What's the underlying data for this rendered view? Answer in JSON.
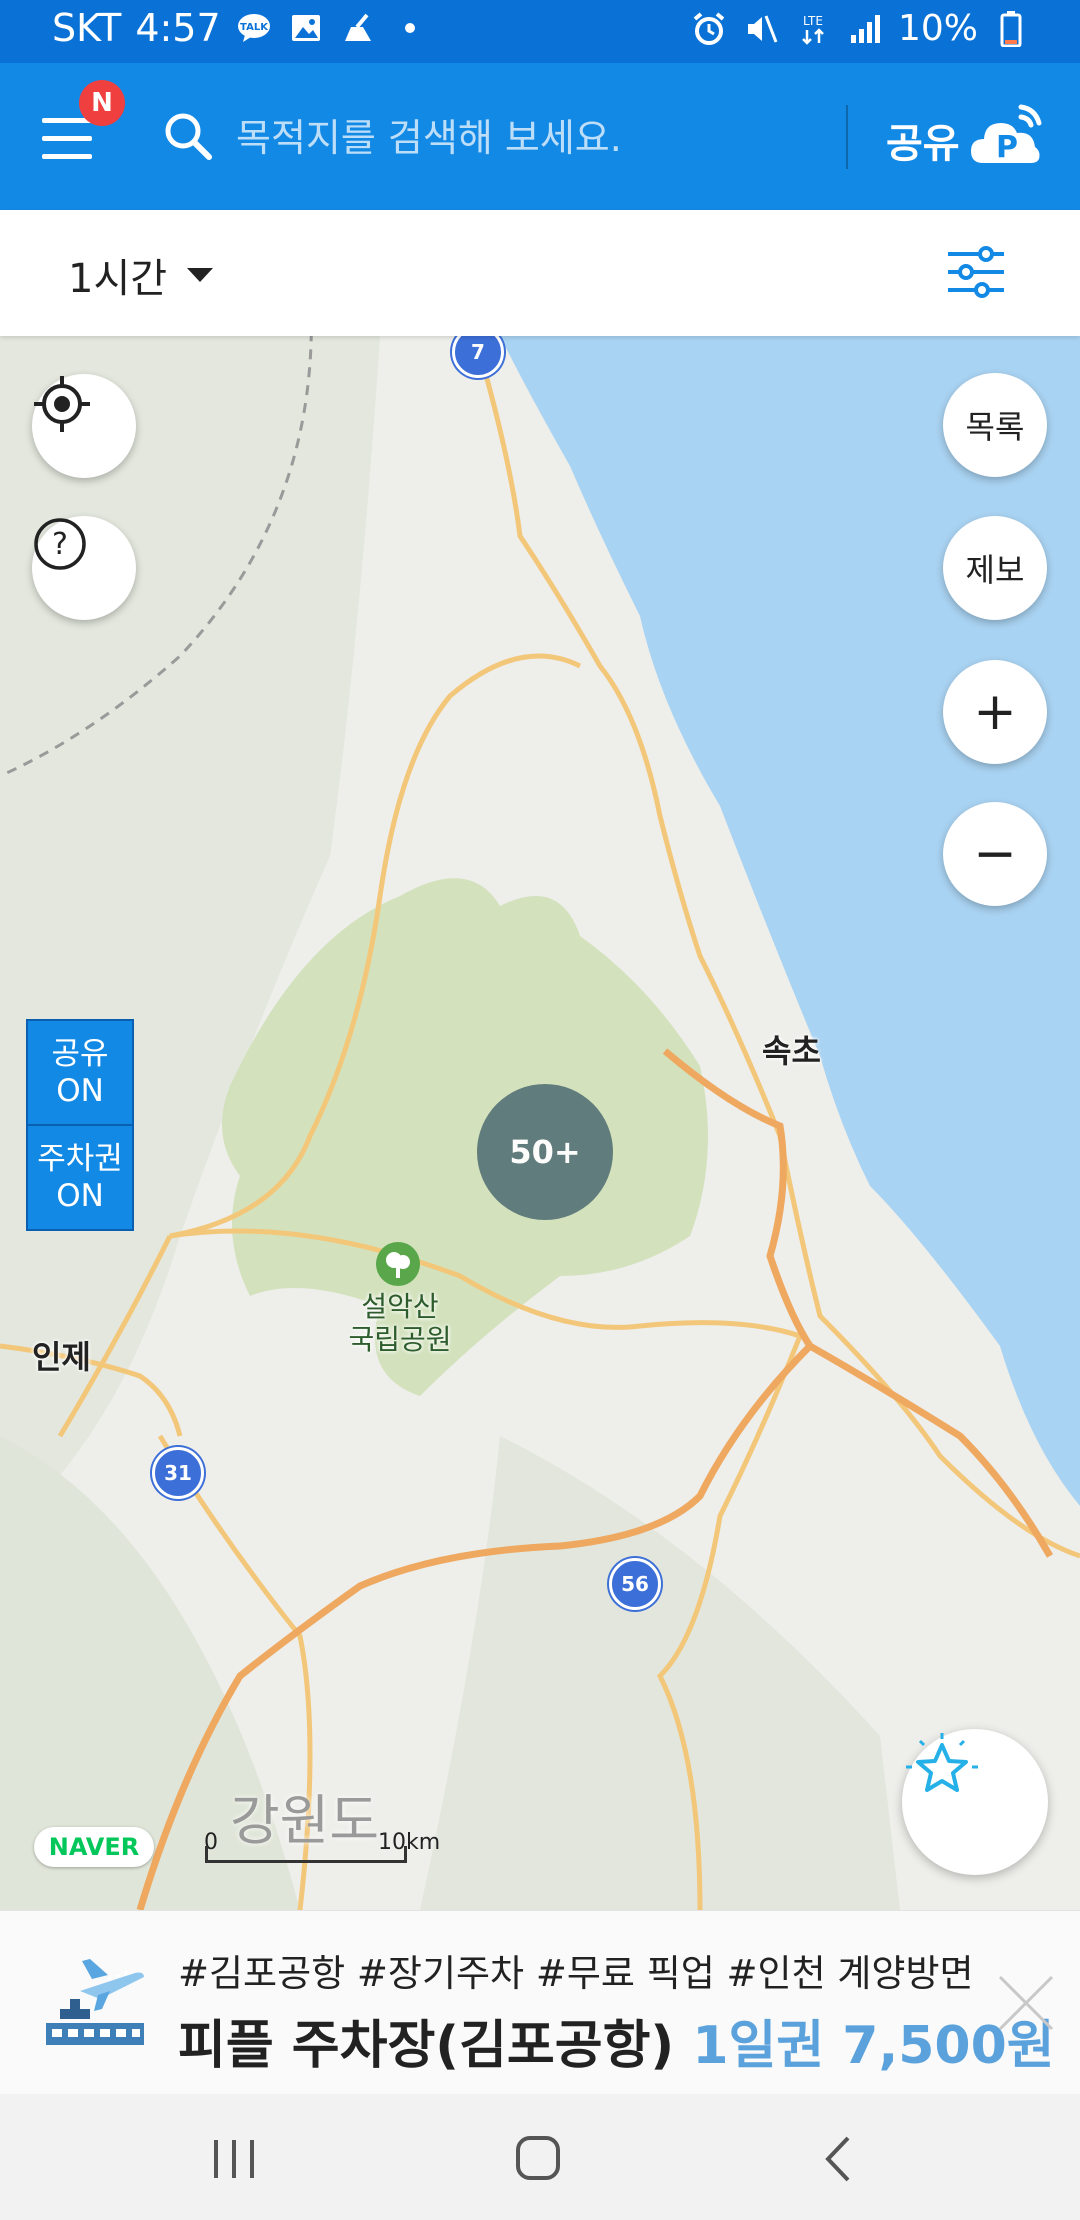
{
  "status_bar": {
    "carrier": "SKT",
    "time": "4:57",
    "battery": "10%",
    "network": "LTE",
    "icons_left": [
      "talk-icon",
      "gallery-icon",
      "cleaner-icon",
      "dot-icon"
    ],
    "icons_right": [
      "alarm-icon",
      "mute-icon",
      "lte-icon",
      "signal-icon",
      "battery-icon"
    ]
  },
  "app_bar": {
    "menu_badge": "N",
    "search_placeholder": "목적지를 검색해 보세요.",
    "share_label": "공유",
    "colors": {
      "primary": "#1389e6",
      "status": "#0a72d6"
    }
  },
  "time_bar": {
    "selected": "1시간"
  },
  "map": {
    "labels": {
      "sokcho": "속초",
      "inje": "인제",
      "park_line1": "설악산",
      "park_line2": "국립공원",
      "province": "강원도"
    },
    "routes": [
      "7",
      "31",
      "56"
    ],
    "cluster": "50+",
    "scale": {
      "start": "0",
      "end": "10km"
    },
    "provider": "NAVER"
  },
  "buttons": {
    "list": "목록",
    "report": "제보",
    "zoom_in": "+",
    "zoom_out": "−",
    "help": "?"
  },
  "toggles": [
    {
      "line1": "공유",
      "line2": "ON"
    },
    {
      "line1": "주차권",
      "line2": "ON"
    }
  ],
  "ad": {
    "tags": "#김포공항 #장기주차 #무료 픽업 #인천 계양방면",
    "title": "피플 주차장(김포공항)",
    "price": "1일권 7,500원"
  }
}
